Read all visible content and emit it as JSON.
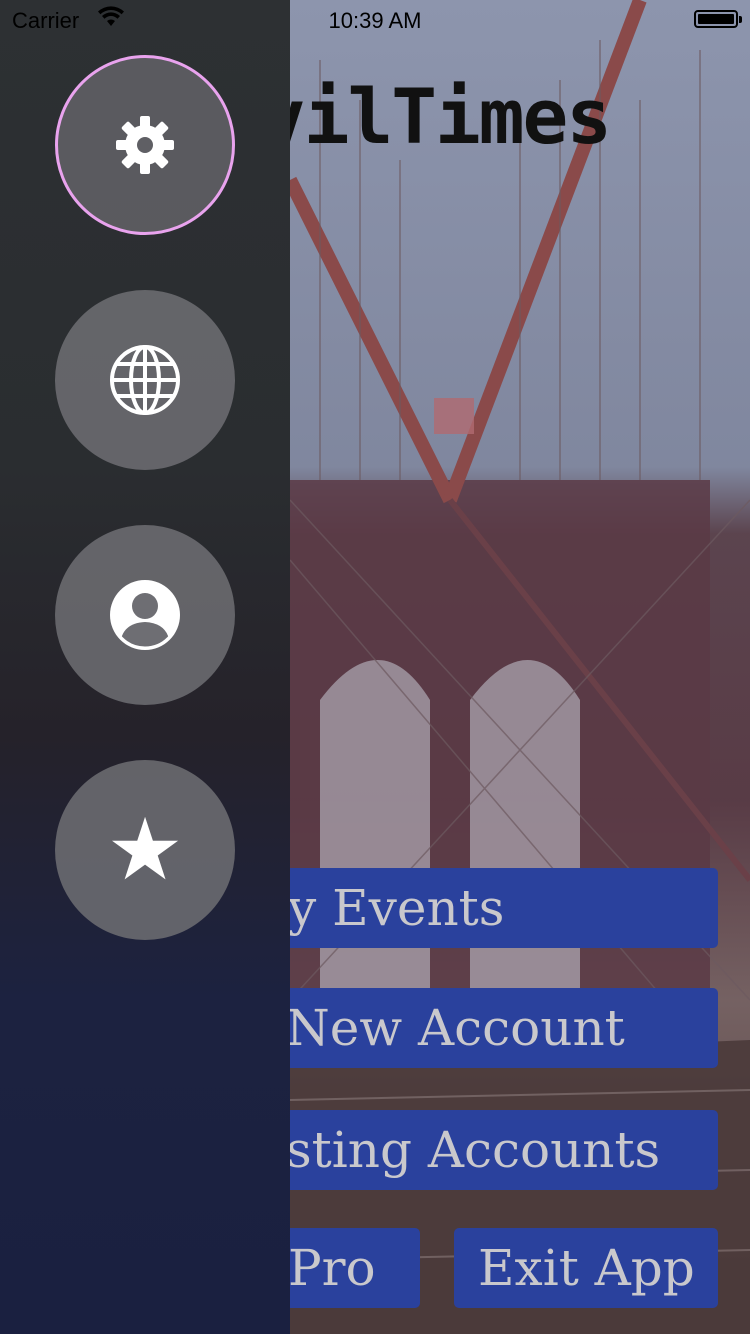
{
  "status_bar": {
    "carrier": "Carrier",
    "time": "10:39 AM"
  },
  "app": {
    "title_visible": "vilTimes"
  },
  "menu": {
    "events": "y Events",
    "new_account": "New Account",
    "existing_accounts": "sting Accounts",
    "pro": "Pro",
    "exit_app": "Exit App"
  },
  "sidebar": {
    "items": [
      {
        "icon": "gear-icon",
        "active": true
      },
      {
        "icon": "globe-icon",
        "active": false
      },
      {
        "icon": "user-icon",
        "active": false
      },
      {
        "icon": "star-icon",
        "active": false
      }
    ],
    "active_ring_color": "#e9a3ee"
  },
  "colors": {
    "button_bg": "#2a419d",
    "button_text": "#c9c8cc"
  },
  "glyphs": {
    "star": "★"
  }
}
